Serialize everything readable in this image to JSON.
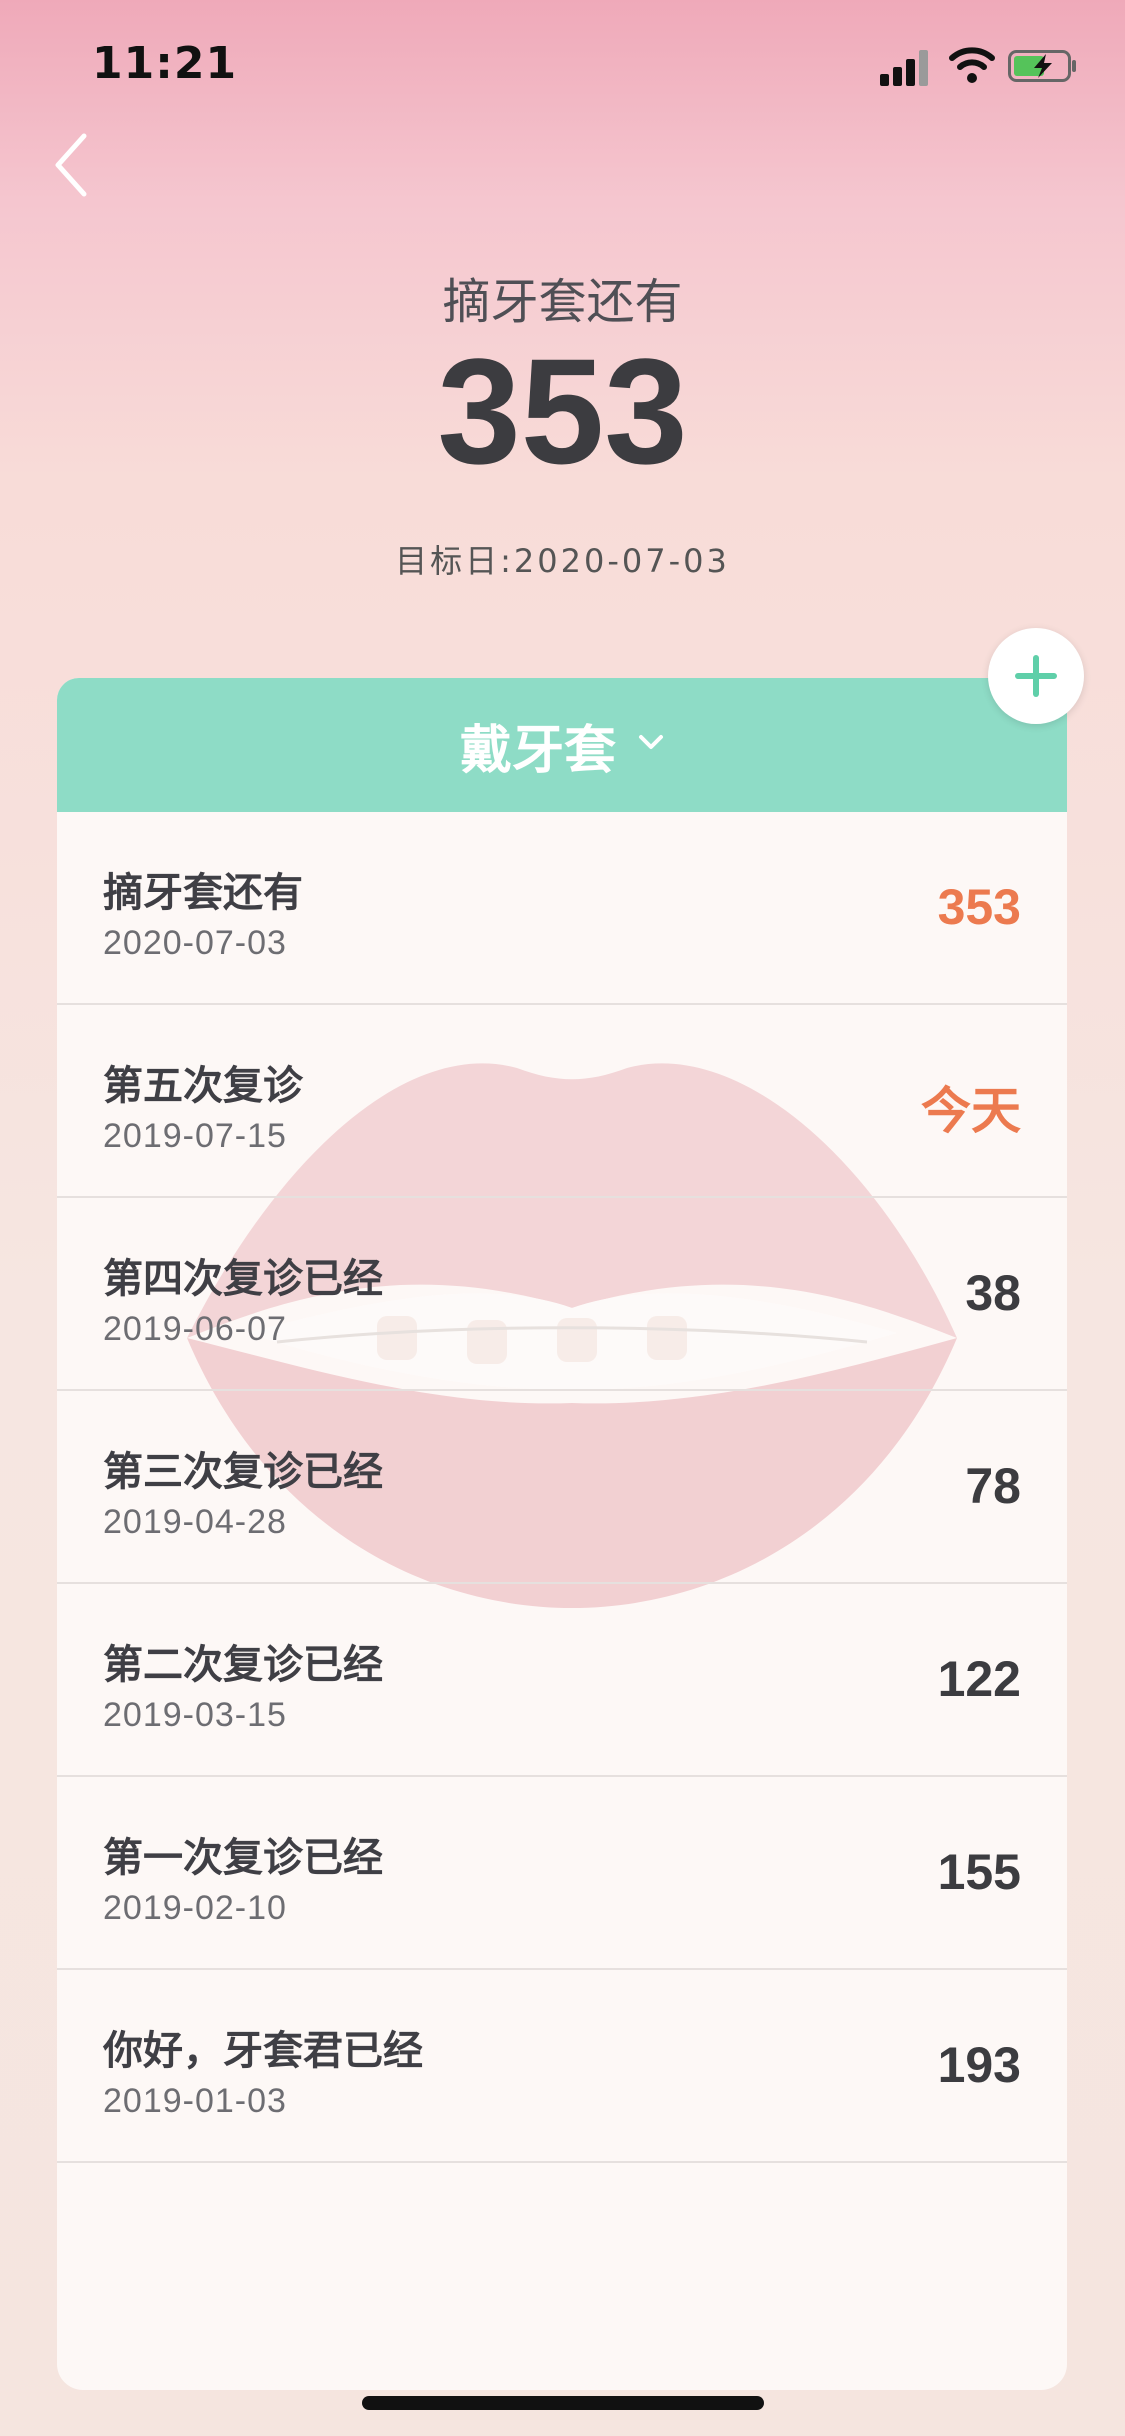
{
  "status_bar": {
    "time": "11:21",
    "battery_state": "charging"
  },
  "hero": {
    "label": "摘牙套还有",
    "days": "353",
    "target_date": "目标日:2020-07-03"
  },
  "card": {
    "header_title": "戴牙套"
  },
  "events": [
    {
      "title": "摘牙套还有",
      "date": "2020-07-03",
      "value": "353",
      "highlight": true
    },
    {
      "title": "第五次复诊",
      "date": "2019-07-15",
      "value": "今天",
      "highlight": true
    },
    {
      "title": "第四次复诊已经",
      "date": "2019-06-07",
      "value": "38",
      "highlight": false
    },
    {
      "title": "第三次复诊已经",
      "date": "2019-04-28",
      "value": "78",
      "highlight": false
    },
    {
      "title": "第二次复诊已经",
      "date": "2019-03-15",
      "value": "122",
      "highlight": false
    },
    {
      "title": "第一次复诊已经",
      "date": "2019-02-10",
      "value": "155",
      "highlight": false
    },
    {
      "title": "你好，牙套君已经",
      "date": "2019-01-03",
      "value": "193",
      "highlight": false
    }
  ],
  "colors": {
    "accent_green": "#8edcc6",
    "highlight_orange": "#ec7a4f",
    "text_dark": "#3c3c40"
  },
  "icons": {
    "back": "chevron-left-icon",
    "add": "plus-icon",
    "dropdown": "chevron-down-icon"
  }
}
